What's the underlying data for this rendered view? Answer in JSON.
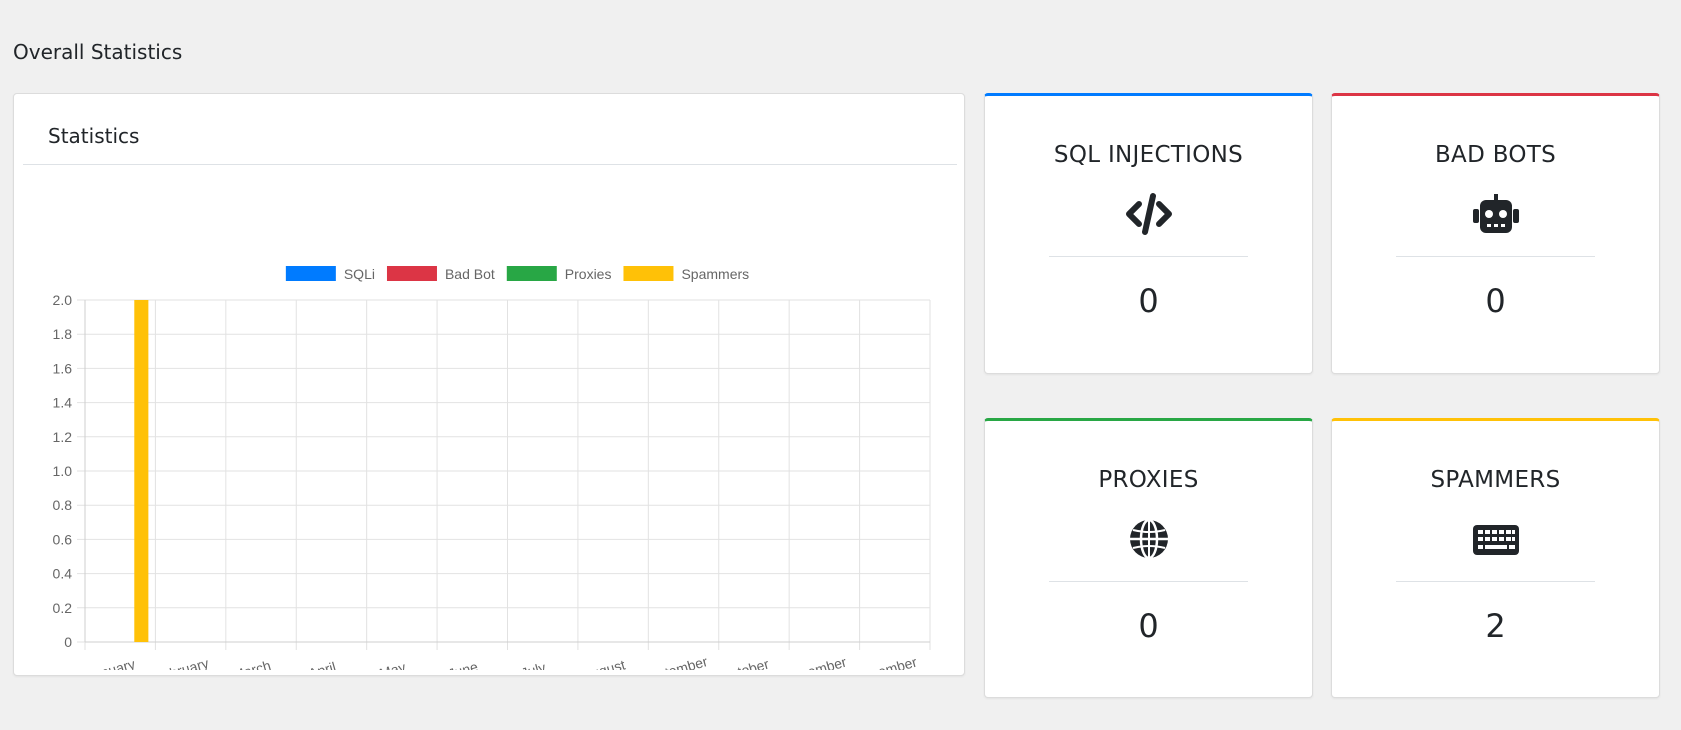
{
  "page": {
    "title": "Overall Statistics"
  },
  "chart_card": {
    "title": "Statistics"
  },
  "chart_data": {
    "type": "bar",
    "categories": [
      "January",
      "February",
      "March",
      "April",
      "May",
      "June",
      "July",
      "August",
      "September",
      "October",
      "November",
      "December"
    ],
    "series": [
      {
        "name": "SQLi",
        "color": "#007bff",
        "values": [
          0,
          0,
          0,
          0,
          0,
          0,
          0,
          0,
          0,
          0,
          0,
          0
        ]
      },
      {
        "name": "Bad Bot",
        "color": "#dc3545",
        "values": [
          0,
          0,
          0,
          0,
          0,
          0,
          0,
          0,
          0,
          0,
          0,
          0
        ]
      },
      {
        "name": "Proxies",
        "color": "#28a745",
        "values": [
          0,
          0,
          0,
          0,
          0,
          0,
          0,
          0,
          0,
          0,
          0,
          0
        ]
      },
      {
        "name": "Spammers",
        "color": "#ffc107",
        "values": [
          2,
          0,
          0,
          0,
          0,
          0,
          0,
          0,
          0,
          0,
          0,
          0
        ]
      }
    ],
    "ylim": [
      0,
      2.0
    ],
    "yticks": [
      "0",
      "0.2",
      "0.4",
      "0.6",
      "0.8",
      "1.0",
      "1.2",
      "1.4",
      "1.6",
      "1.8",
      "2.0"
    ],
    "grid": true,
    "legend": "top-center"
  },
  "stats": [
    {
      "title": "SQL INJECTIONS",
      "icon": "code-icon",
      "value": "0",
      "accent": "#007bff"
    },
    {
      "title": "BAD BOTS",
      "icon": "robot-icon",
      "value": "0",
      "accent": "#dc3545"
    },
    {
      "title": "PROXIES",
      "icon": "globe-icon",
      "value": "0",
      "accent": "#28a745"
    },
    {
      "title": "SPAMMERS",
      "icon": "keyboard-icon",
      "value": "2",
      "accent": "#ffc107"
    }
  ]
}
